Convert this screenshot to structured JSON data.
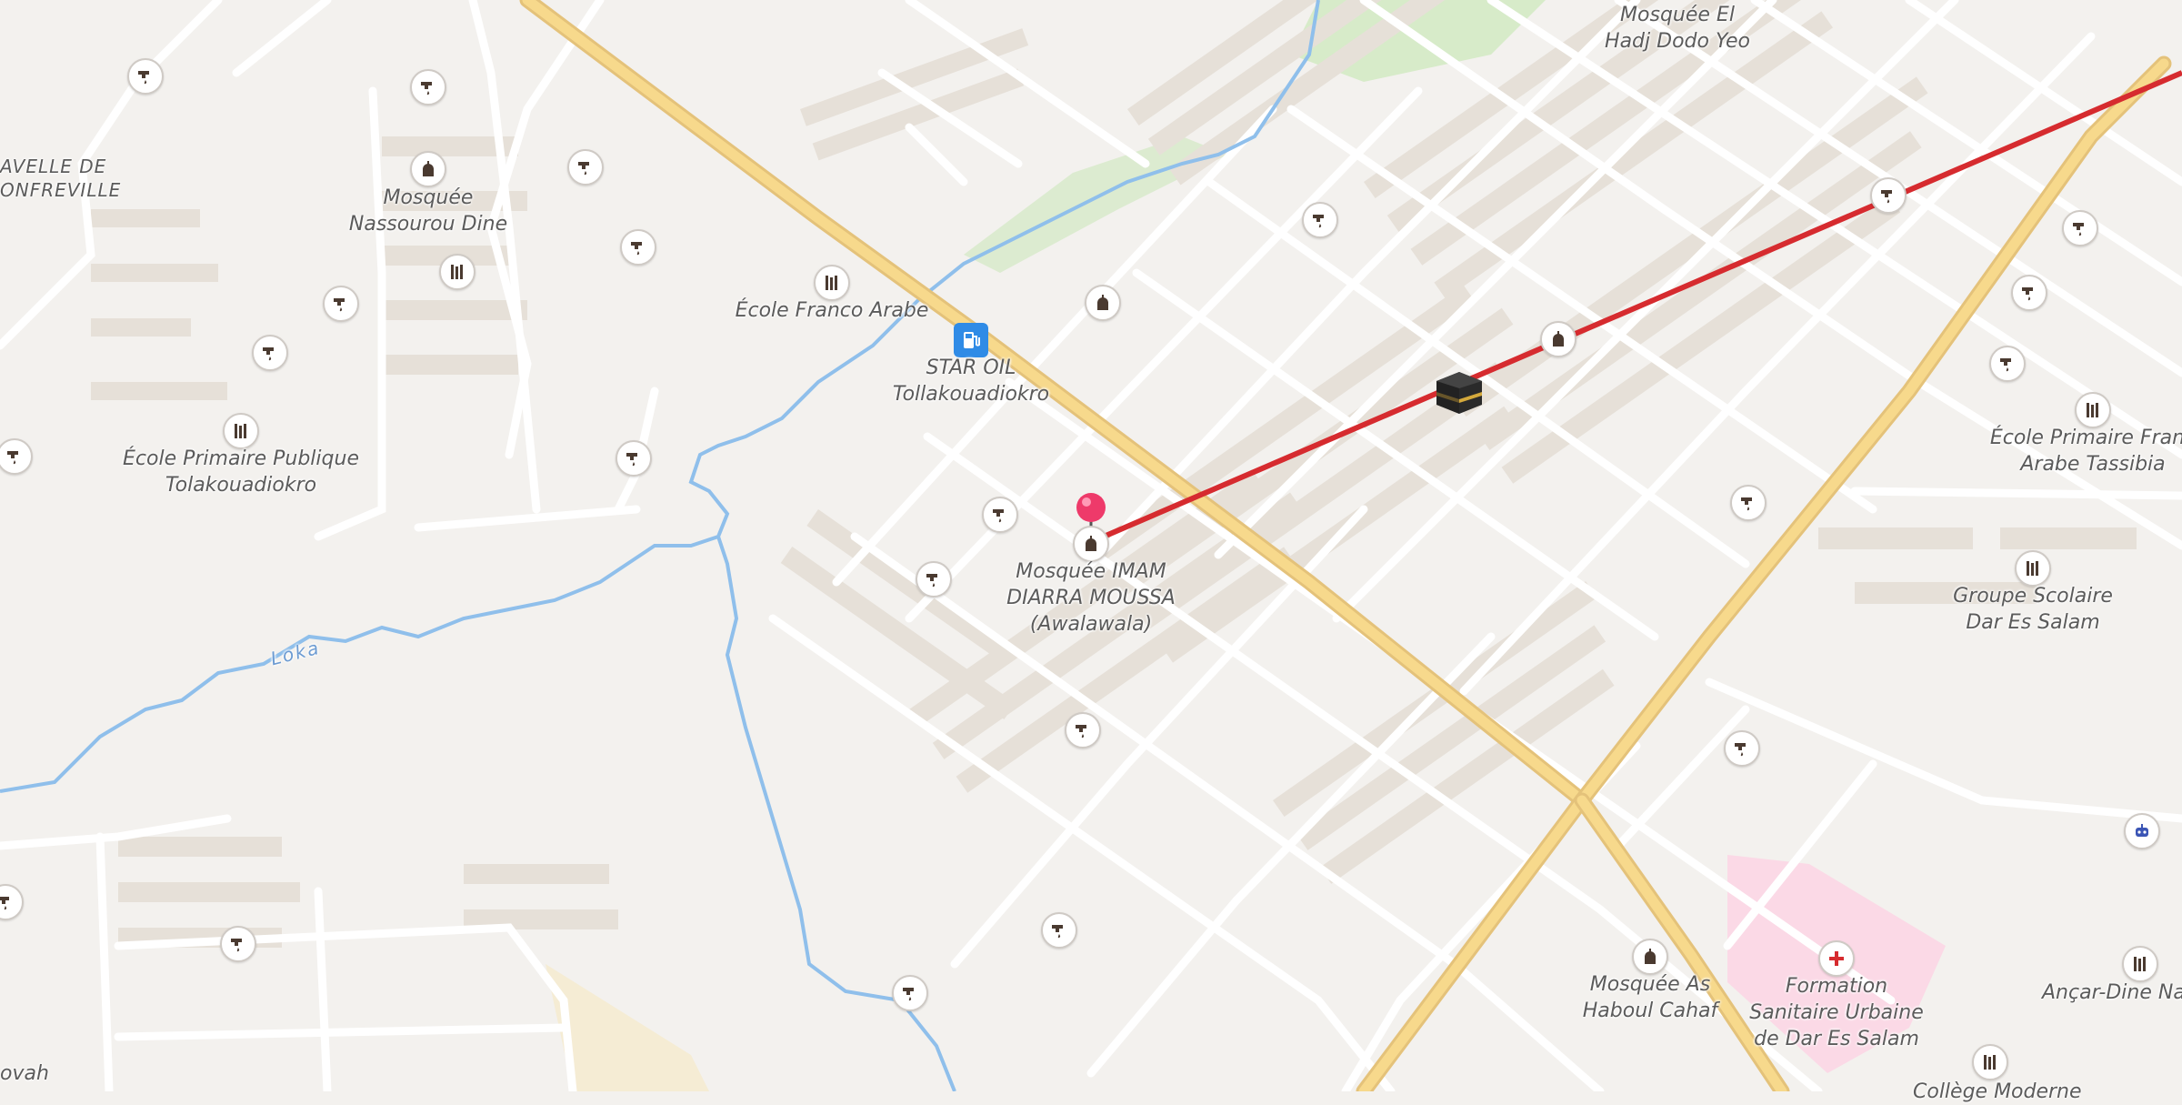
{
  "map": {
    "river_name": "Loka",
    "colors": {
      "background": "#f3f1ee",
      "road_major": "#f7d98c",
      "road_major_casing": "#e4c27a",
      "road_minor": "#ffffff",
      "water": "#8fbfeb",
      "park": "#d7ebc9",
      "hospital_area": "#fbd9e6",
      "building": "#e6e0d8",
      "qibla_line": "#d62b2f",
      "pin": "#ee3a6a"
    },
    "labels": {
      "mosquee_el_hadj": [
        "Mosquée El",
        "Hadj Dodo Yeo"
      ],
      "nouvelle_bonfreville": [
        "AVELLE DE",
        "ONFREVILLE"
      ],
      "mosquee_nassourou": [
        "Mosquée",
        "Nassourou Dine"
      ],
      "ecole_franco_arabe": [
        "École Franco Arabe"
      ],
      "star_oil": [
        "STAR OIL",
        "Tollakouadiokro"
      ],
      "ecole_primaire_publique": [
        "École Primaire Publique",
        "Tolakouadiokro"
      ],
      "mosquee_imam": [
        "Mosquée IMAM",
        "DIARRA MOUSSA",
        "(Awalawala)"
      ],
      "ecole_primaire_franco_tassibia": [
        "École Primaire Franc",
        "Arabe Tassibia"
      ],
      "groupe_scolaire": [
        "Groupe Scolaire",
        "Dar Es Salam"
      ],
      "mosquee_as_haboul": [
        "Mosquée As",
        "Haboul Cahaf"
      ],
      "formation_sanitaire": [
        "Formation",
        "Sanitaire Urbaine",
        "de Dar Es Salam"
      ],
      "ancar_dine": [
        "Ançar-Dine Nat"
      ],
      "college_moderne": [
        "Collège Moderne"
      ],
      "ovah": [
        "ovah"
      ]
    }
  }
}
